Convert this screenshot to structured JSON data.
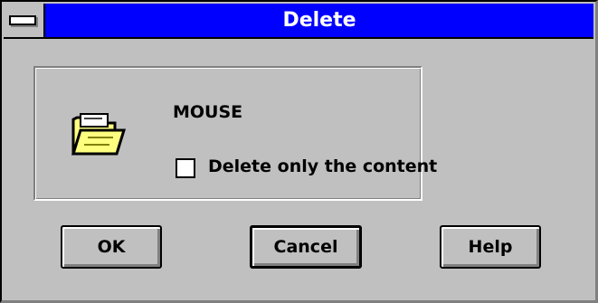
{
  "window": {
    "title": "Delete"
  },
  "dialog": {
    "item_name": "MOUSE",
    "checkbox_label": "Delete only the content",
    "checkbox_checked": false
  },
  "buttons": {
    "ok": "OK",
    "cancel": "Cancel",
    "help": "Help"
  },
  "icons": {
    "system_menu": "system-menu-icon",
    "item": "folder-icon"
  },
  "colors": {
    "title_bar": "#0000ff",
    "face": "#c0c0c0",
    "folder": "#ffff80"
  }
}
